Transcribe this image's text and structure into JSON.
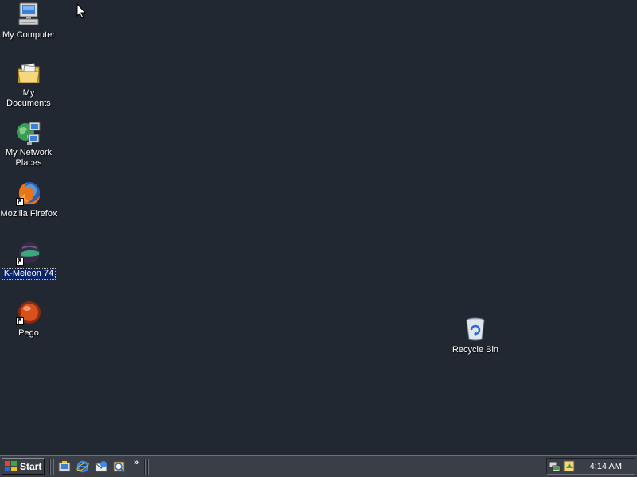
{
  "desktop": {
    "icons": [
      {
        "label": "My Computer",
        "icon": "computer-icon"
      },
      {
        "label": "My Documents",
        "icon": "folder-icon"
      },
      {
        "label": "My Network Places",
        "icon": "network-icon"
      },
      {
        "label": "Mozilla Firefox",
        "icon": "firefox-icon"
      },
      {
        "label": "K-Meleon 74",
        "icon": "kmeleon-icon",
        "selected": true
      },
      {
        "label": "Pego",
        "icon": "pego-icon"
      },
      {
        "label": "Recycle Bin",
        "icon": "recycle-bin-icon"
      }
    ],
    "background_color": "#222831"
  },
  "taskbar": {
    "start_label": "Start",
    "quick_launch": [
      {
        "icon": "show-desktop-icon"
      },
      {
        "icon": "internet-explorer-icon"
      },
      {
        "icon": "outlook-express-icon"
      },
      {
        "icon": "media-icon"
      }
    ],
    "chevron": "»",
    "tray_icons": [
      {
        "icon": "network-tray-icon"
      },
      {
        "icon": "volume-tray-icon"
      }
    ],
    "clock": "4:14 AM"
  }
}
